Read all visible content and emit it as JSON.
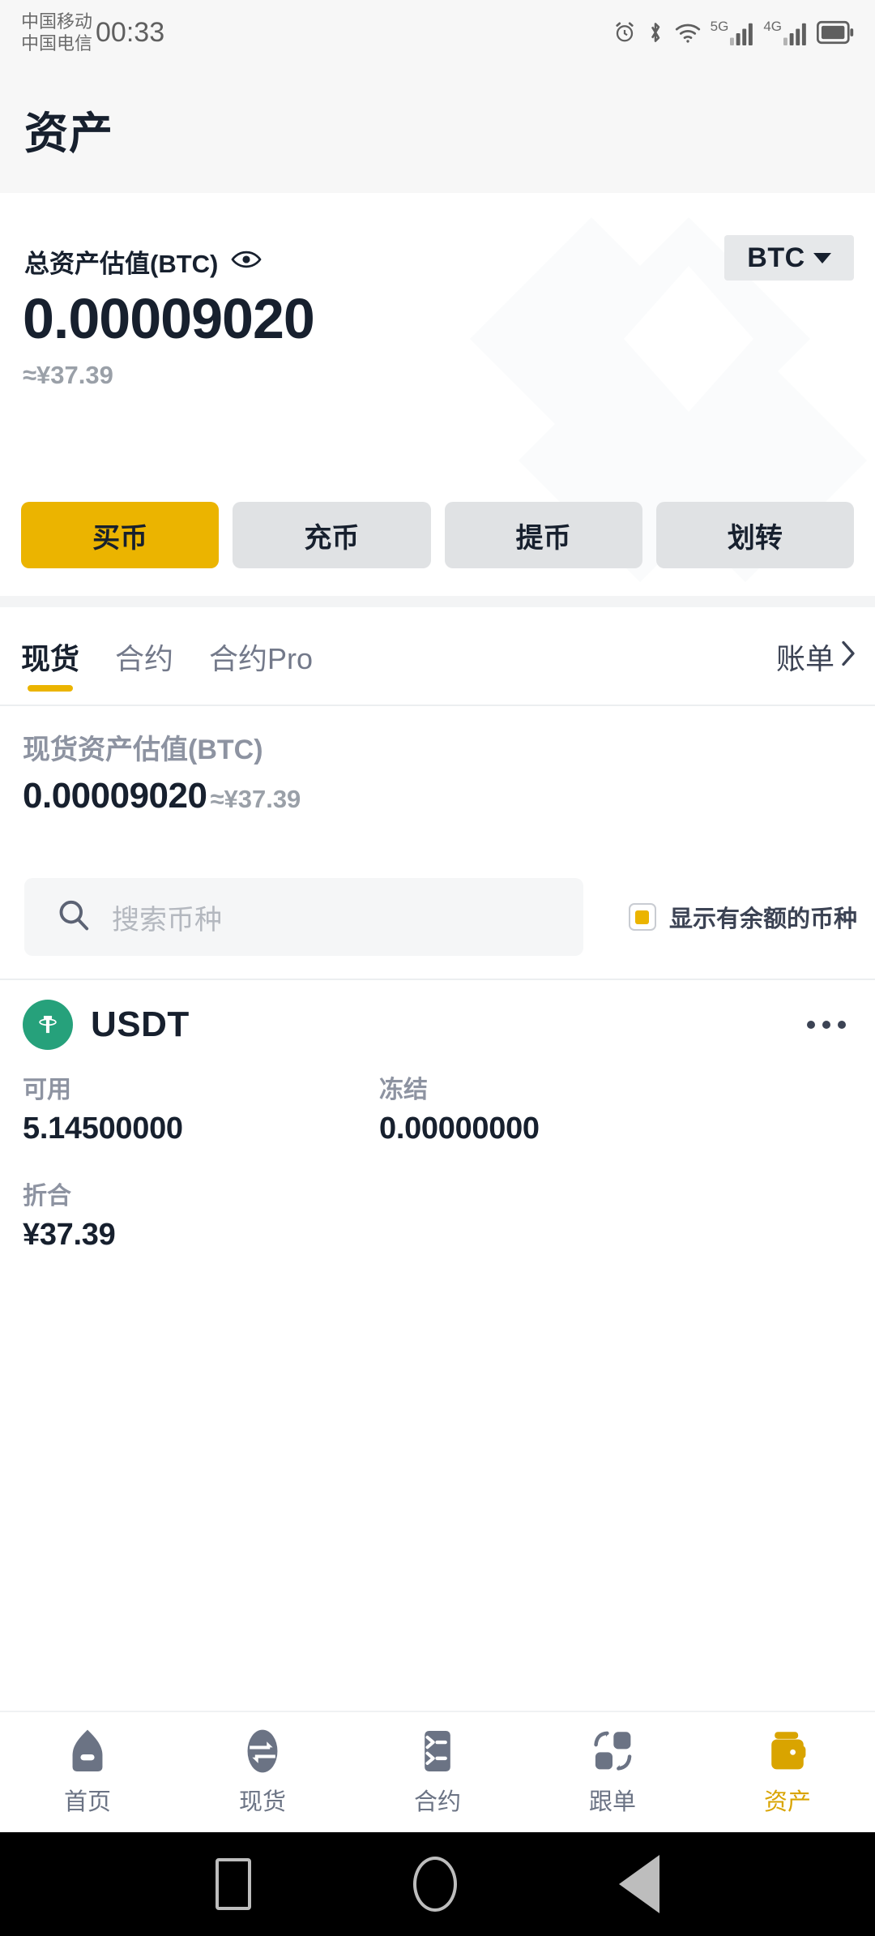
{
  "status_bar": {
    "carrier_primary": "中国移动",
    "carrier_secondary": "中国电信",
    "time": "00:33",
    "icons": [
      "alarm-icon",
      "bluetooth-icon",
      "wifi-icon",
      "signal-5g-icon",
      "signal-4g-icon",
      "battery-icon"
    ],
    "network_5g_label": "5G",
    "network_4g_label": "4G"
  },
  "header": {
    "title": "资产"
  },
  "total_assets": {
    "label": "总资产估值(BTC)",
    "eye_icon": "eye-icon",
    "currency_selector": "BTC",
    "amount": "0.00009020",
    "fiat_equivalent": "≈¥37.39"
  },
  "actions": [
    {
      "label": "买币",
      "style": "primary"
    },
    {
      "label": "充币",
      "style": "default"
    },
    {
      "label": "提币",
      "style": "default"
    },
    {
      "label": "划转",
      "style": "default"
    }
  ],
  "tabs": {
    "items": [
      {
        "label": "现货",
        "active": true
      },
      {
        "label": "合约",
        "active": false
      },
      {
        "label": "合约Pro",
        "active": false
      }
    ],
    "bill_link": "账单"
  },
  "spot_valuation": {
    "label": "现货资产估值(BTC)",
    "amount": "0.00009020",
    "fiat_equivalent": "≈¥37.39"
  },
  "search": {
    "placeholder": "搜索币种",
    "icon": "search-icon",
    "filter_label": "显示有余额的币种",
    "filter_checked": true
  },
  "coins": [
    {
      "symbol": "USDT",
      "logo_color": "#26a17b",
      "menu_icon": "more-options-icon",
      "available_label": "可用",
      "available_value": "5.14500000",
      "frozen_label": "冻结",
      "frozen_value": "0.00000000",
      "equivalent_label": "折合",
      "equivalent_value": "¥37.39"
    }
  ],
  "bottom_nav": [
    {
      "label": "首页",
      "icon": "home-icon",
      "active": false
    },
    {
      "label": "现货",
      "icon": "exchange-icon",
      "active": false
    },
    {
      "label": "合约",
      "icon": "contract-list-icon",
      "active": false
    },
    {
      "label": "跟单",
      "icon": "copy-trade-icon",
      "active": false
    },
    {
      "label": "资产",
      "icon": "wallet-icon",
      "active": true
    }
  ],
  "android_nav": [
    {
      "name": "recents-button",
      "icon": "square-icon"
    },
    {
      "name": "home-button",
      "icon": "circle-icon"
    },
    {
      "name": "back-button",
      "icon": "triangle-left-icon"
    }
  ],
  "theme": {
    "accent": "#ebb400",
    "accent_dark": "#d9a400",
    "text_primary": "#17202e",
    "text_muted": "#8d93a1",
    "usdt_green": "#26a17b"
  }
}
